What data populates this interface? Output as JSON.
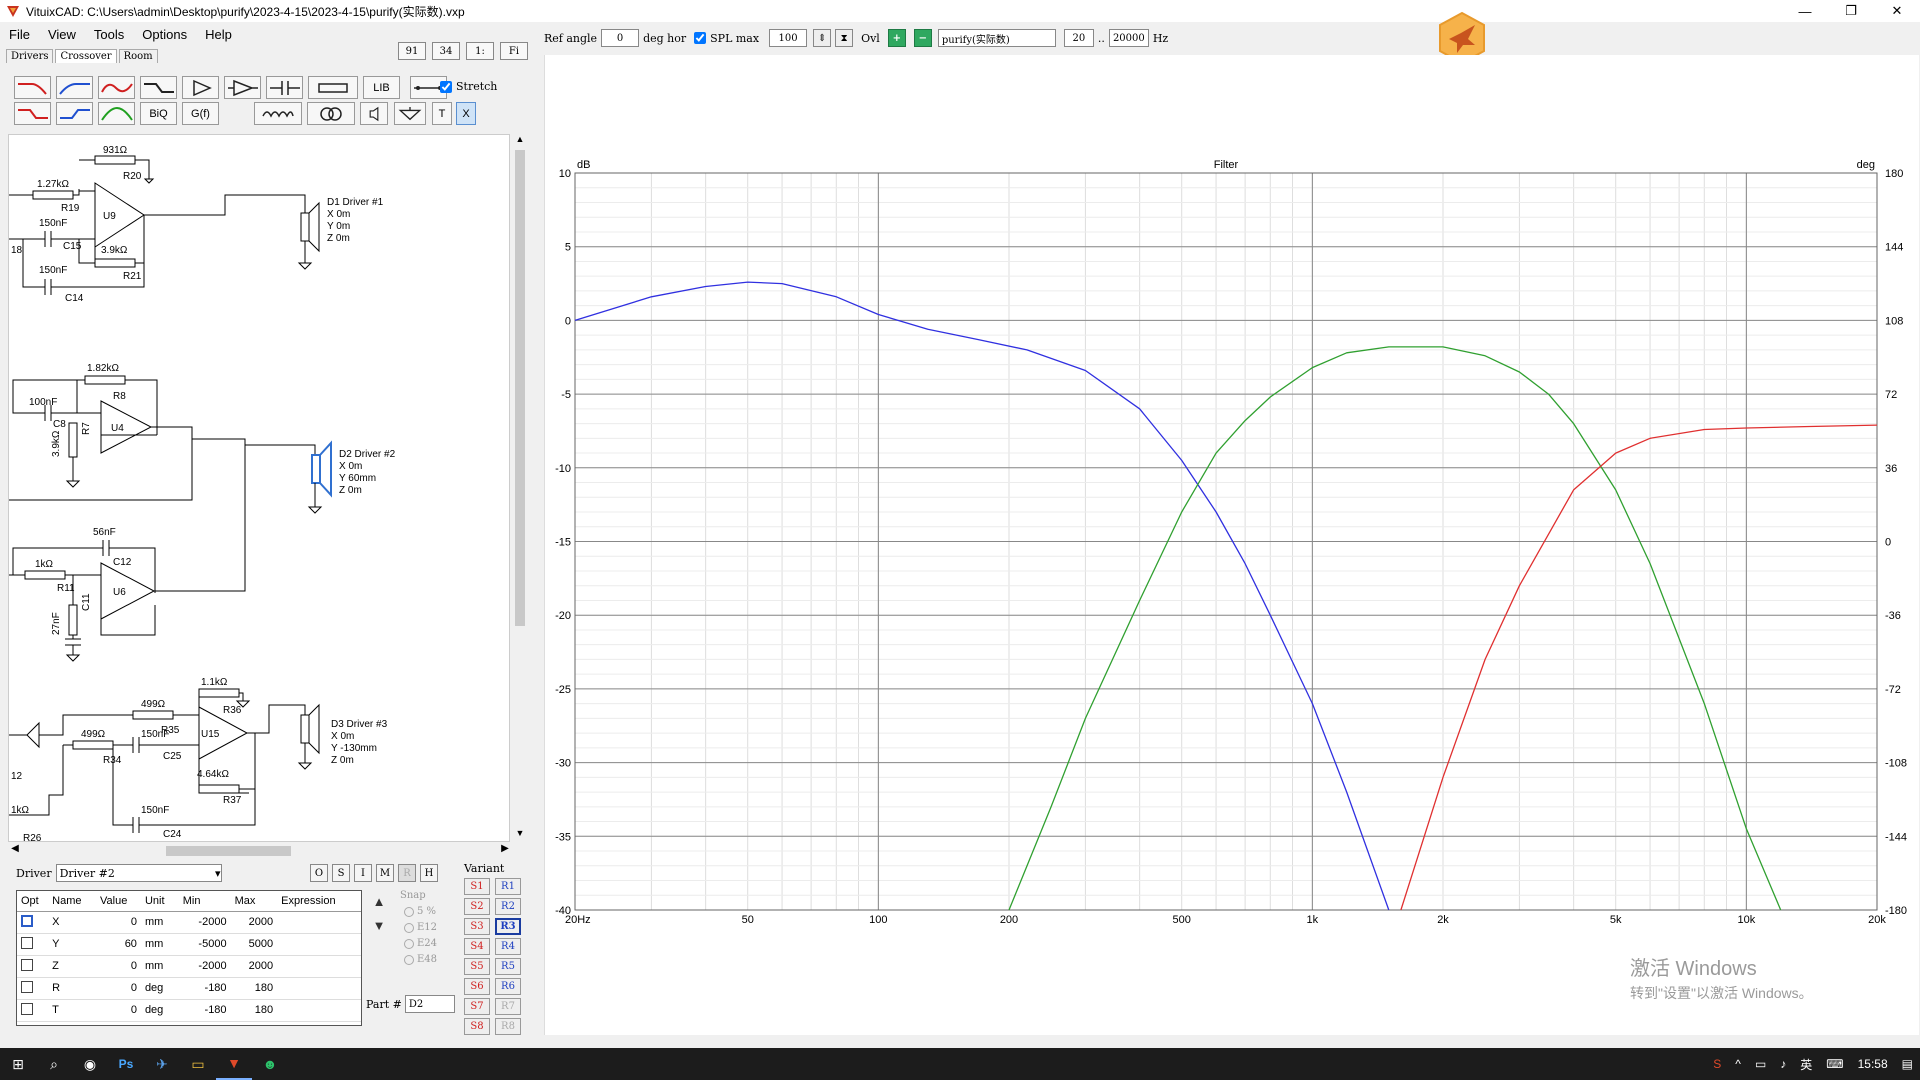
{
  "window": {
    "title": "VituixCAD: C:\\Users\\admin\\Desktop\\purify\\2023-4-15\\2023-4-15\\purify(实际数).vxp",
    "minimize": "—",
    "maximize": "❐",
    "close": "✕"
  },
  "menu": [
    "File",
    "View",
    "Tools",
    "Options",
    "Help"
  ],
  "tabs": [
    "Drivers",
    "Crossover",
    "Room"
  ],
  "topnums": [
    "91",
    "34",
    "1:",
    "Fi"
  ],
  "toolbar": {
    "lib": "LIB",
    "biq": "BiQ",
    "gf": "G(f)",
    "t": "T",
    "x": "X",
    "stretch": "Stretch"
  },
  "schematic": {
    "labels": {
      "r20v": "931Ω",
      "r20": "R20",
      "r19v": "1.27kΩ",
      "r19": "R19",
      "u9": "U9",
      "c15v": "150nF",
      "c15": "C15",
      "r21v": "3.9kΩ",
      "r21": "R21",
      "c14v": "150nF",
      "c14": "C14",
      "n18": "18",
      "r8v": "1.82kΩ",
      "r8": "R8",
      "c8v": "100nF",
      "c8": "C8",
      "r7v": "3.9kΩ",
      "r7": "R7",
      "u4": "U4",
      "c12v": "56nF",
      "c12": "C12",
      "r11v": "1kΩ",
      "r11": "R11",
      "c11v": "27nF",
      "c11": "C11",
      "u6": "U6",
      "r36v": "1.1kΩ",
      "r36": "R36",
      "r35v": "499Ω",
      "r35": "R35",
      "u15": "U15",
      "r34v": "499Ω",
      "r34": "R34",
      "c25v": "150nF",
      "c25": "C25",
      "r37v": "4.64kΩ",
      "r37": "R37",
      "c24v": "150nF",
      "c24": "C24",
      "n12": "12",
      "r26v": "1kΩ",
      "r26": "R26"
    },
    "drivers": [
      {
        "name": "D1 Driver #1",
        "x": "X 0m",
        "y": "Y 0m",
        "z": "Z 0m"
      },
      {
        "name": "D2 Driver #2",
        "x": "X 0m",
        "y": "Y 60mm",
        "z": "Z 0m"
      },
      {
        "name": "D3 Driver #3",
        "x": "X 0m",
        "y": "Y -130mm",
        "z": "Z 0m"
      }
    ]
  },
  "driver_select": {
    "label": "Driver",
    "value": "Driver #2"
  },
  "osimrh": [
    "O",
    "S",
    "I",
    "M",
    "R",
    "H"
  ],
  "params": {
    "headers": [
      "Opt",
      "Name",
      "Value",
      "Unit",
      "Min",
      "Max",
      "Expression"
    ],
    "rows": [
      {
        "name": "X",
        "value": "0",
        "unit": "mm",
        "min": "-2000",
        "max": "2000"
      },
      {
        "name": "Y",
        "value": "60",
        "unit": "mm",
        "min": "-5000",
        "max": "5000"
      },
      {
        "name": "Z",
        "value": "0",
        "unit": "mm",
        "min": "-2000",
        "max": "2000"
      },
      {
        "name": "R",
        "value": "0",
        "unit": "deg",
        "min": "-180",
        "max": "180"
      },
      {
        "name": "T",
        "value": "0",
        "unit": "deg",
        "min": "-180",
        "max": "180"
      }
    ]
  },
  "snap": {
    "label": "Snap",
    "options": [
      "5 %",
      "E12",
      "E24",
      "E48"
    ]
  },
  "part": {
    "label": "Part #",
    "value": "D2"
  },
  "variant": {
    "label": "Variant",
    "s": [
      "S1",
      "S2",
      "S3",
      "S4",
      "S5",
      "S6",
      "S7",
      "S8"
    ],
    "r": [
      "R1",
      "R2",
      "R3",
      "R4",
      "R5",
      "R6",
      "R7",
      "R8"
    ],
    "selected": "R3"
  },
  "topctrl": {
    "ref_angle_label": "Ref angle",
    "ref_angle": "0",
    "deg_hor": "deg hor",
    "spl_max_label": "SPL max",
    "spl_max": "100",
    "ovl": "Ovl",
    "plus": "+",
    "minus": "−",
    "name": "purify(实际数)",
    "f_min": "20",
    "dots": "..",
    "f_max": "20000",
    "hz": "Hz"
  },
  "chart_data": {
    "type": "line",
    "title": "Filter",
    "ylabel": "dB",
    "y2label": "deg",
    "xscale": "log",
    "xlim": [
      20,
      20000
    ],
    "ylim": [
      -40,
      10
    ],
    "y2lim": [
      -180,
      180
    ],
    "xticks": [
      20,
      50,
      100,
      200,
      500,
      1000,
      2000,
      5000,
      10000,
      20000
    ],
    "xticklabels": [
      "20Hz",
      "50",
      "100",
      "200",
      "500",
      "1k",
      "2k",
      "5k",
      "10k",
      "20k"
    ],
    "yticks": [
      10,
      5,
      0,
      -5,
      -10,
      -15,
      -20,
      -25,
      -30,
      -35,
      -40
    ],
    "y2ticks": [
      180,
      144,
      108,
      72,
      36,
      0,
      -36,
      -72,
      -108,
      -144,
      -180
    ],
    "grid": true,
    "series": [
      {
        "color": "#3030e0",
        "x": [
          20,
          30,
          40,
          50,
          60,
          80,
          100,
          130,
          170,
          220,
          300,
          400,
          500,
          600,
          700,
          800,
          1000,
          1200,
          1500
        ],
        "y": [
          0,
          1.6,
          2.3,
          2.6,
          2.5,
          1.6,
          0.4,
          -0.6,
          -1.3,
          -2.0,
          -3.4,
          -6.0,
          -9.5,
          -13.0,
          -16.5,
          -20.0,
          -26.0,
          -32.0,
          -40.0
        ]
      },
      {
        "color": "#30a030",
        "x": [
          200,
          250,
          300,
          400,
          500,
          600,
          700,
          800,
          1000,
          1200,
          1500,
          2000,
          2500,
          3000,
          3500,
          4000,
          5000,
          6000,
          8000,
          10000,
          12000
        ],
        "y": [
          -40,
          -33,
          -27,
          -19,
          -13,
          -9,
          -6.8,
          -5.2,
          -3.2,
          -2.2,
          -1.8,
          -1.8,
          -2.4,
          -3.5,
          -5.0,
          -7.0,
          -11.5,
          -16.5,
          -26.0,
          -34.5,
          -40.0
        ]
      },
      {
        "color": "#e03030",
        "x": [
          1600,
          2000,
          2500,
          3000,
          4000,
          5000,
          6000,
          8000,
          10000,
          14000,
          20000
        ],
        "y": [
          -40,
          -31,
          -23,
          -18,
          -11.5,
          -9.0,
          -8.0,
          -7.4,
          -7.3,
          -7.2,
          -7.1
        ]
      }
    ]
  },
  "watermark": {
    "line1": "激活 Windows",
    "line2": "转到\"设置\"以激活 Windows。"
  },
  "taskbar": {
    "time": "15:58",
    "ime": "英",
    "ps": "Ps"
  }
}
